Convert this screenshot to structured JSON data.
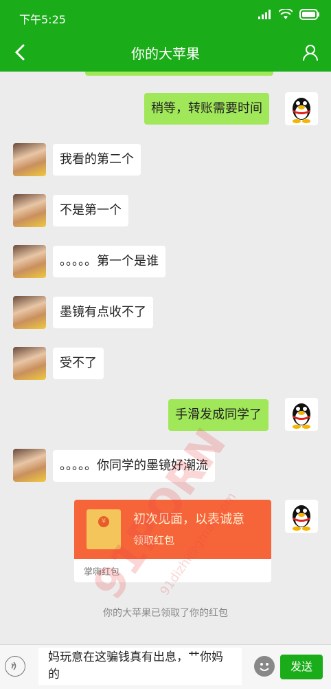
{
  "status_bar": {
    "time": "下午5:25"
  },
  "title_bar": {
    "title": "你的大苹果"
  },
  "messages": [
    {
      "side": "out",
      "text": "稍等，转账需要时间"
    },
    {
      "side": "in",
      "text": "我看的第二个"
    },
    {
      "side": "in",
      "text": "不是第一个"
    },
    {
      "side": "in",
      "text": "。。。。。第一个是谁"
    },
    {
      "side": "in",
      "text": "墨镜有点收不了"
    },
    {
      "side": "in",
      "text": "受不了"
    },
    {
      "side": "out",
      "text": "手滑发成同学了"
    },
    {
      "side": "in",
      "text": "。。。。。你同学的墨镜好潮流"
    }
  ],
  "red_packet": {
    "greeting": "初次见面，以表诚意",
    "action": "领取红包",
    "footer": "掌嗨红包",
    "symbol": "¥"
  },
  "system_note": "你的大苹果已领取了你的红包",
  "input_bar": {
    "text": "妈玩意在这骗钱真有出息，艹你妈的",
    "send_label": "发送"
  },
  "watermark": {
    "big": "91PORN",
    "email": "91dizhi@gmail.com"
  },
  "colors": {
    "header_green": "#1aad19",
    "bubble_green": "#a0e759",
    "packet_orange": "#f6643a"
  }
}
